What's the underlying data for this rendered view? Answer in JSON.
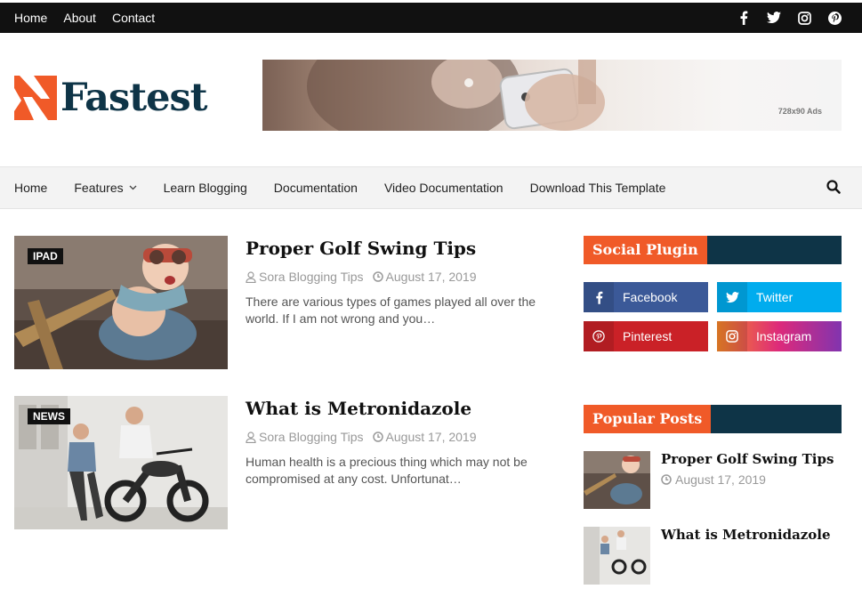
{
  "topbar": {
    "links": [
      "Home",
      "About",
      "Contact"
    ],
    "social_icons": [
      "facebook-icon",
      "twitter-icon",
      "instagram-icon",
      "pinterest-icon"
    ]
  },
  "brand": {
    "name": "Fastest",
    "accent": "#f05a28",
    "dark": "#0e3447"
  },
  "ad": {
    "label": "728x90 Ads"
  },
  "nav": {
    "items": [
      "Home",
      "Features",
      "Learn Blogging",
      "Documentation",
      "Video Documentation",
      "Download This Template"
    ]
  },
  "posts": [
    {
      "badge": "IPAD",
      "title": "Proper Golf Swing Tips",
      "author": "Sora Blogging Tips",
      "date": "August 17, 2019",
      "excerpt": "There are various types of games played all over the world. If I am not wrong and you…"
    },
    {
      "badge": "NEWS",
      "title": "What is Metronidazole",
      "author": "Sora Blogging Tips",
      "date": "August 17, 2019",
      "excerpt": "Human health is a precious thing which may not be compromised at any cost. Unfortunat…"
    }
  ],
  "sidebar": {
    "social_title": "Social Plugin",
    "social": [
      {
        "label": "Facebook",
        "color": "#3b5998"
      },
      {
        "label": "Twitter",
        "color": "#00acee"
      },
      {
        "label": "Pinterest",
        "color": "#ca2127"
      },
      {
        "label": "Instagram",
        "color": "#dd2a7b"
      }
    ],
    "popular_title": "Popular Posts",
    "popular": [
      {
        "title": "Proper Golf Swing Tips",
        "date": "August 17, 2019"
      },
      {
        "title": "What is Metronidazole"
      }
    ]
  }
}
